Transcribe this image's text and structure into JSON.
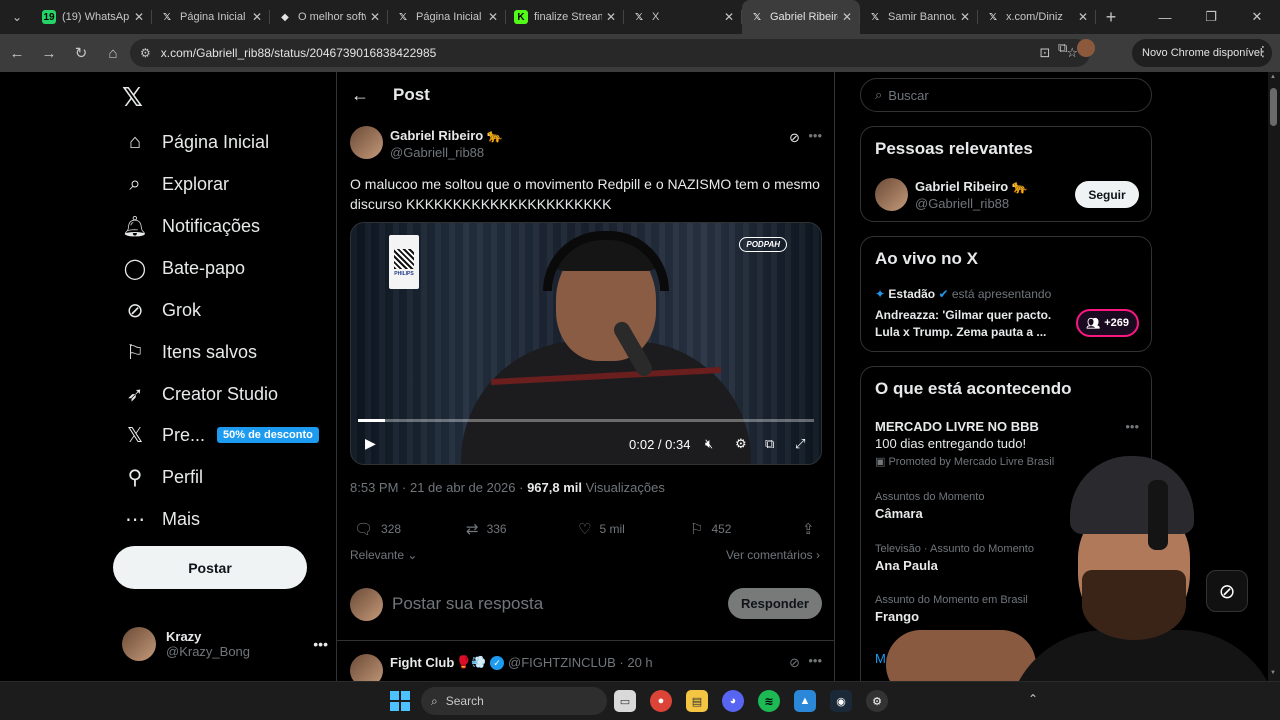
{
  "browser": {
    "tabs": [
      {
        "title": "(19) WhatsApp",
        "favicon": "whatsapp-icon",
        "fav_text": "19",
        "fav_color": "#25d366",
        "active": false
      },
      {
        "title": "Página Inicial / X",
        "favicon": "x-icon",
        "fav_text": "𝕏",
        "fav_color": "#1f1f1f",
        "active": false
      },
      {
        "title": "O melhor software",
        "favicon": "diamond-icon",
        "fav_text": "◆",
        "fav_color": "#1f1f1f",
        "active": false
      },
      {
        "title": "Página Inicial / X",
        "favicon": "x-icon",
        "fav_text": "𝕏",
        "fav_color": "#1f1f1f",
        "active": false
      },
      {
        "title": "finalize Stream",
        "favicon": "kick-icon",
        "fav_text": "K",
        "fav_color": "#53fc18",
        "active": false
      },
      {
        "title": "X",
        "favicon": "x-icon",
        "fav_text": "𝕏",
        "fav_color": "#1f1f1f",
        "active": false
      },
      {
        "title": "Gabriel Ribeiro",
        "favicon": "x-icon",
        "fav_text": "𝕏",
        "fav_color": "#3c3c3c",
        "active": true
      },
      {
        "title": "Samir Bannout",
        "favicon": "x-icon",
        "fav_text": "𝕏",
        "fav_color": "#1f1f1f",
        "active": false
      },
      {
        "title": "x.com/Diniz",
        "favicon": "x-icon",
        "fav_text": "𝕏",
        "fav_color": "#1f1f1f",
        "active": false
      }
    ],
    "url": "x.com/Gabriell_rib88/status/2046739016838422985",
    "update_label": "Novo Chrome disponível"
  },
  "nav": {
    "items": [
      {
        "label": "Página Inicial",
        "icon": "home-icon",
        "glyph": "⌂"
      },
      {
        "label": "Explorar",
        "icon": "search-icon",
        "glyph": "⌕"
      },
      {
        "label": "Notificações",
        "icon": "bell-icon",
        "glyph": "🔔︎"
      },
      {
        "label": "Bate-papo",
        "icon": "chat-icon",
        "glyph": "◯"
      },
      {
        "label": "Grok",
        "icon": "grok-icon",
        "glyph": "⊘"
      },
      {
        "label": "Itens salvos",
        "icon": "bookmark-icon",
        "glyph": "⚐"
      },
      {
        "label": "Creator Studio",
        "icon": "rocket-icon",
        "glyph": "➶"
      },
      {
        "label": "Pre...",
        "icon": "x-premium-icon",
        "glyph": "𝕏"
      },
      {
        "label": "Perfil",
        "icon": "person-icon",
        "glyph": "⚲"
      },
      {
        "label": "Mais",
        "icon": "more-circle-icon",
        "glyph": "⋯"
      }
    ],
    "premium_badge": "50% de desconto",
    "post_label": "Postar",
    "account": {
      "name": "Krazy",
      "handle": "@Krazy_Bong"
    }
  },
  "post": {
    "header_title": "Post",
    "author_name": "Gabriel Ribeiro 🐆",
    "author_handle": "@Gabriell_rib88",
    "text": "O malucoo me soltou que o movimento Redpill e o NAZISMO tem o mesmo discurso KKKKKKKKKKKKKKKKKKKKKK",
    "video": {
      "time": "0:02 / 0:34",
      "progress": 0.06,
      "qr_brand": "PHILIPS",
      "channel_logo": "PODPAH"
    },
    "timestamp": "8:53 PM · 21 de abr de 2026 · ",
    "views_value": "967,8 mil",
    "views_label": " Visualizações",
    "stats": {
      "replies": "328",
      "reposts": "336",
      "likes": "5 mil",
      "bookmarks": "452"
    },
    "sort_label": "Relevante",
    "comments_link": "Ver comentários",
    "reply_placeholder": "Postar sua resposta",
    "reply_button": "Responder"
  },
  "next_tweet": {
    "name": "Fight Club",
    "emoji": "🥊💨",
    "handle_time": "@FIGHTZINCLUB · 20 h"
  },
  "sidebar": {
    "search_placeholder": "Buscar",
    "relevant_title": "Pessoas relevantes",
    "relevant_person": {
      "name": "Gabriel Ribeiro 🐆",
      "handle": "@Gabriell_rib88",
      "follow": "Seguir"
    },
    "live_title": "Ao vivo no X",
    "live": {
      "source": "Estadão",
      "status": " está apresentando",
      "headline": "Andreazza: 'Gilmar quer pacto. Lula x Trump. Zema pauta a ...",
      "count": "+269"
    },
    "trends_title": "O que está acontecendo",
    "trends": [
      {
        "context": "",
        "name": "MERCADO LIVRE NO BBB",
        "sub": "100 dias entregando tudo!",
        "promo": "Promoted by Mercado Livre Brasil"
      },
      {
        "context": "Assuntos do Momento",
        "name": "Câmara"
      },
      {
        "context": "Televisão · Assunto do Momento",
        "name": "Ana Paula"
      },
      {
        "context": "Assunto do Momento em Brasil",
        "name": "Frango"
      }
    ],
    "show_more": "Mostrar mais"
  },
  "taskbar": {
    "search_label": "Search"
  }
}
